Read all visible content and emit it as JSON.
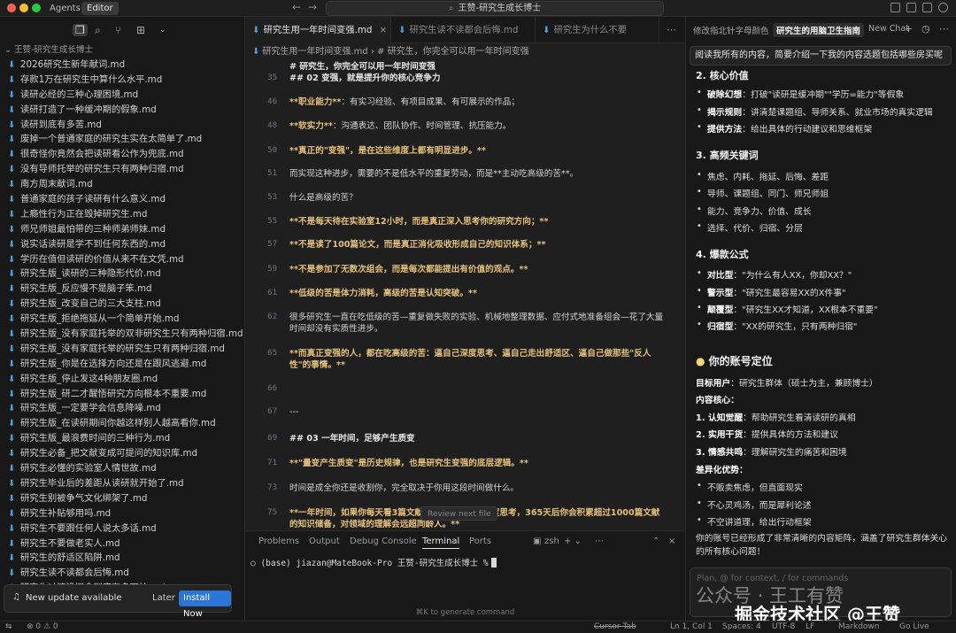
{
  "titlebar": {
    "mode_tabs": [
      "Agents",
      "Editor"
    ],
    "search_title": "王赞-研究生成长博士",
    "colors": {
      "close": "#ff5f57",
      "minimize": "#febc2e",
      "maximize": "#28c840"
    }
  },
  "sidebar": {
    "root_label": "王赞-研究生成长博士",
    "files": [
      "2026研究生新年献词.md",
      "存款1万在研究生中算什么水平.md",
      "读研必经的三种心理困境.md",
      "读研打造了一种缓冲期的假象.md",
      "读研到底有多苦.md",
      "废掉一个普通家庭的研究生实在太简单了.md",
      "很奇怪你竟然会把读研看公作为兜底.md",
      "没有导师托举的研究生只有两种归宿.md",
      "南方周末献词.md",
      "普通家庭的孩子读研有什么意义.md",
      "上瘾性行为正在毁掉研究生.md",
      "师兄师姐最怕带的三种师弟师妹.md",
      "说实话读研是学不到任何东西的.md",
      "学历在值但读研的价值从来不在文凭.md",
      "研究生版_读研的三种隐形代价.md",
      "研究生版_反应慢不是脑子笨.md",
      "研究生版_改变自己的三大支柱.md",
      "研究生版_拒绝拖延从一个简单开始.md",
      "研究生版_没有家庭托举的双非研究生只有两种归宿.md",
      "研究生版_没有家庭托举的研究生只有两种归宿.md",
      "研究生版_你是在选择方向还是在跟风逃避.md",
      "研究生版_停止发这4种朋友圈.md",
      "研究生版_研二才醒悟研究方向根本不重要.md",
      "研究生版_一定要学会信息降噪.md",
      "研究生版_在读研期间你越这样别人越高看你.md",
      "研究生版_最浪费时间的三种行为.md",
      "研究生必备_把文献变成可提问的知识库.md",
      "研究生必懂的实验室人情世故.md",
      "研究生毕业后的差距从读研就开始了.md",
      "研究生别被争气文化绑架了.md",
      "研究生补贴够用吗.md",
      "研究生不要跟任何人说太多话.md",
      "研究生不要做老实人.md",
      "研究生的舒适区陷阱.md",
      "研究生读不读都会后悔.md",
      "研究生过渡没概念到底有多可怕.md"
    ],
    "update": {
      "message": "New update available",
      "later": "Later",
      "install": "Install Now"
    }
  },
  "editor": {
    "tabs": [
      "研究生用一年时间变强.md",
      "研究生读不读都会后悔.md",
      "研究生为什么不要"
    ],
    "breadcrumb": [
      "研究生用一年时间变强.md",
      "# 研究生，你完全可以用一年时间变强"
    ],
    "lines": [
      {
        "n": "",
        "t": "# 研究生，你完全可以用一年时间变强",
        "s": "head"
      },
      {
        "n": "35",
        "t": "## 02 变强，就是提升你的核心竞争力",
        "s": "head"
      },
      {
        "n": "46",
        "t": "**职业能力**：有实习经验、有项目成果、有可展示的作品；",
        "s": "mix"
      },
      {
        "n": "48",
        "t": "**软实力**：沟通表达、团队协作、时间管理、抗压能力。",
        "s": "mix"
      },
      {
        "n": "50",
        "t": "**真正的\"变强\"，是在这些维度上都有明显进步。**",
        "s": "bold"
      },
      {
        "n": "51",
        "t": "而实现这种进步，需要的不是低水平的重复劳动，而是**主动吃高级的苦**。",
        "s": "plain"
      },
      {
        "n": "53",
        "t": "什么是高级的苦？",
        "s": "plain"
      },
      {
        "n": "55",
        "t": "**不是每天待在实验室12小时，而是真正深入思考你的研究方向；**",
        "s": "bold"
      },
      {
        "n": "57",
        "t": "**不是读了100篇论文，而是真正消化吸收形成自己的知识体系；**",
        "s": "bold"
      },
      {
        "n": "59",
        "t": "**不是参加了无数次组会，而是每次都能提出有价值的观点。**",
        "s": "bold"
      },
      {
        "n": "61",
        "t": "**低级的苦是体力消耗，高级的苦是认知突破。**",
        "s": "bold"
      },
      {
        "n": "62",
        "t": "很多研究生一直在吃低级的苦—重复做失败的实验、机械地整理数据、应付式地准备组会—花了大量时间却没有实质性进步。",
        "s": "plain"
      },
      {
        "n": "65",
        "t": "**而真正变强的人，都在吃高级的苦：逼自己深度思考、逼自己走出舒适区、逼自己做那些\"反人性\"的事情。**",
        "s": "bold"
      },
      {
        "n": "66",
        "t": "",
        "s": "plain"
      },
      {
        "n": "67",
        "t": "---",
        "s": "plain"
      },
      {
        "n": "69",
        "t": "## 03 一年时间，足够产生质变",
        "s": "head"
      },
      {
        "n": "71",
        "t": "**\"量变产生质变\"是历史规律，也是研究生变强的底层逻辑。**",
        "s": "bold"
      },
      {
        "n": "73",
        "t": "时间是成全你还是收割你，完全取决于你用这段时间做什么。",
        "s": "plain"
      },
      {
        "n": "75",
        "t": "**一年时间，如果你每天看3篇文献、认真做笔记、深度思考，365天后你会积累超过1000篇文献的知识储备，对领域的理解会远超同龄人。**",
        "s": "bold"
      },
      {
        "n": "76",
        "t": "",
        "s": "plain"
      },
      {
        "n": "77",
        "t": "**一年时间，如果你每天写500字的论文，坚持下来就是18万字，足够完成一篇硕士论文外加两篇小论文。**",
        "s": "bold"
      }
    ],
    "review_pill": "Review next file"
  },
  "panel": {
    "tabs": [
      "Problems",
      "Output",
      "Debug Console",
      "Terminal",
      "Ports"
    ],
    "shell": "zsh",
    "prompt": "(base) jiazan@MateBook-Pro 王赞-研究生成长博士 %",
    "hint": "⌘K to generate command"
  },
  "chat": {
    "tabs": [
      "修改指北针字母颜色",
      "研究生的用脑卫生指南",
      "New Chat"
    ],
    "user_message": "阅读我所有的内容，简要介绍一下我的内容选题包括哪些房买呢",
    "sec_value": {
      "title": "2. 核心价值",
      "items": [
        {
          "k": "破除幻想",
          "v": "：打破\"读研是缓冲期\"\"学历=能力\"等假象"
        },
        {
          "k": "揭示规则",
          "v": "：讲清楚课题组、导师关系、就业市场的真实逻辑"
        },
        {
          "k": "提供方法",
          "v": "：给出具体的行动建议和思维框架"
        }
      ]
    },
    "sec_keywords": {
      "title": "3. 高频关键词",
      "items": [
        "焦虑、内耗、拖延、后悔、差距",
        "导师、课题组、同门、师兄师姐",
        "能力、竞争力、价值、成长",
        "选择、代价、归宿、分层"
      ]
    },
    "sec_formula": {
      "title": "4. 爆款公式",
      "items": [
        {
          "k": "对比型",
          "v": "：\"为什么有人XX，你却XX？\""
        },
        {
          "k": "警示型",
          "v": "：\"研究生最容易XX的X件事\""
        },
        {
          "k": "颠覆型",
          "v": "：\"研究生XX才知道，XX根本不重要\""
        },
        {
          "k": "归宿型",
          "v": "：\"XX的研究生，只有两种归宿\""
        }
      ]
    },
    "positioning": {
      "title": "你的账号定位",
      "target_label": "目标用户",
      "target_value": "：研究生群体（硕士为主，兼顾博士）",
      "core_label": "内容核心：",
      "core_items": [
        {
          "k": "1. 认知觉醒",
          "v": "：帮助研究生看清读研的真相"
        },
        {
          "k": "2. 实用干货",
          "v": "：提供具体的方法和建议"
        },
        {
          "k": "3. 情感共鸣",
          "v": "：理解研究生的痛苦和困境"
        }
      ],
      "diff_label": "差异化优势：",
      "diff_items": [
        "不贩卖焦虑，但直面现实",
        "不心灵鸡汤，而是犀利论述",
        "不空讲道理，给出行动框架"
      ],
      "summary": "你的账号已经形成了非常清晰的内容矩阵，涵盖了研究生群体关心的所有核心问题！"
    },
    "input_placeholder": "Plan, @ for context, / for commands",
    "watermark_1": "公众号 · 王工有赞",
    "watermark_2": "掘金技术社区 @王赞"
  },
  "statusbar": {
    "problems": "⊗ 0 ⚠ 0",
    "cursor_tab": "Cursor Tab",
    "position": "Ln 1, Col 1",
    "spaces": "Spaces: 4",
    "encoding": "UTF-8",
    "eol": "LF",
    "language": "Markdown",
    "go_live": "Go Live"
  }
}
